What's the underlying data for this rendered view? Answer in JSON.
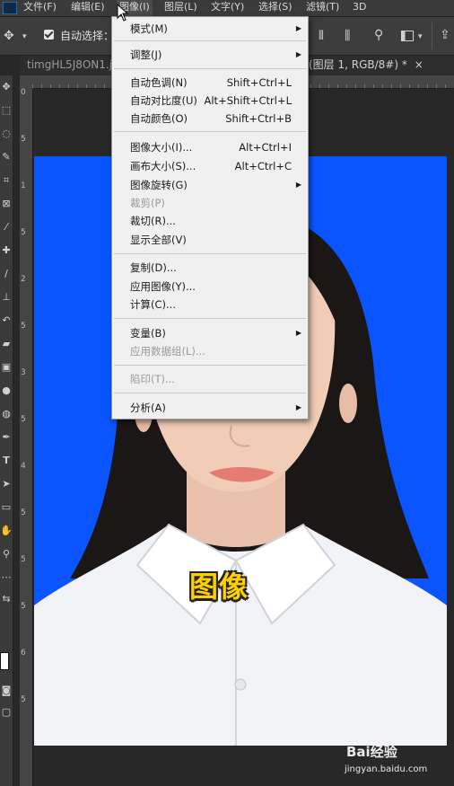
{
  "menubar": {
    "items": [
      "文件(F)",
      "编辑(E)",
      "图像(I)",
      "图层(L)",
      "文字(Y)",
      "选择(S)",
      "滤镜(T)",
      "3D"
    ]
  },
  "options_bar": {
    "auto_select_label": "自动选择："
  },
  "tabs": {
    "left": "timgHL5J8ON1.jp",
    "right": "(图层 1, RGB/8#) *",
    "close": "×"
  },
  "ruler_left": [
    "0",
    "5",
    "1",
    "5",
    "2",
    "5",
    "3",
    "5",
    "4",
    "5",
    "5",
    "5",
    "6",
    "5"
  ],
  "image_menu": {
    "items": [
      {
        "label": "模式(M)",
        "shortcut": "",
        "submenu": true,
        "disabled": false
      },
      {
        "label": "调整(J)",
        "shortcut": "",
        "submenu": true,
        "disabled": false
      },
      {
        "label": "自动色调(N)",
        "shortcut": "Shift+Ctrl+L",
        "submenu": false,
        "disabled": false
      },
      {
        "label": "自动对比度(U)",
        "shortcut": "Alt+Shift+Ctrl+L",
        "submenu": false,
        "disabled": false
      },
      {
        "label": "自动颜色(O)",
        "shortcut": "Shift+Ctrl+B",
        "submenu": false,
        "disabled": false
      },
      {
        "label": "图像大小(I)...",
        "shortcut": "Alt+Ctrl+I",
        "submenu": false,
        "disabled": false
      },
      {
        "label": "画布大小(S)...",
        "shortcut": "Alt+Ctrl+C",
        "submenu": false,
        "disabled": false
      },
      {
        "label": "图像旋转(G)",
        "shortcut": "",
        "submenu": true,
        "disabled": false
      },
      {
        "label": "裁剪(P)",
        "shortcut": "",
        "submenu": false,
        "disabled": true
      },
      {
        "label": "裁切(R)...",
        "shortcut": "",
        "submenu": false,
        "disabled": false
      },
      {
        "label": "显示全部(V)",
        "shortcut": "",
        "submenu": false,
        "disabled": false
      },
      {
        "label": "复制(D)...",
        "shortcut": "",
        "submenu": false,
        "disabled": false
      },
      {
        "label": "应用图像(Y)...",
        "shortcut": "",
        "submenu": false,
        "disabled": false
      },
      {
        "label": "计算(C)...",
        "shortcut": "",
        "submenu": false,
        "disabled": false
      },
      {
        "label": "变量(B)",
        "shortcut": "",
        "submenu": true,
        "disabled": false
      },
      {
        "label": "应用数据组(L)...",
        "shortcut": "",
        "submenu": false,
        "disabled": true
      },
      {
        "label": "陷印(T)...",
        "shortcut": "",
        "submenu": false,
        "disabled": true
      },
      {
        "label": "分析(A)",
        "shortcut": "",
        "submenu": true,
        "disabled": false
      }
    ]
  },
  "caption": "图像",
  "watermark": {
    "brand": "Bai经验",
    "url": "jingyan.baidu.com"
  },
  "colors": {
    "photo_background": "#0a55ff",
    "caption": "#ffd000",
    "menu_background": "#f0f0f0"
  }
}
